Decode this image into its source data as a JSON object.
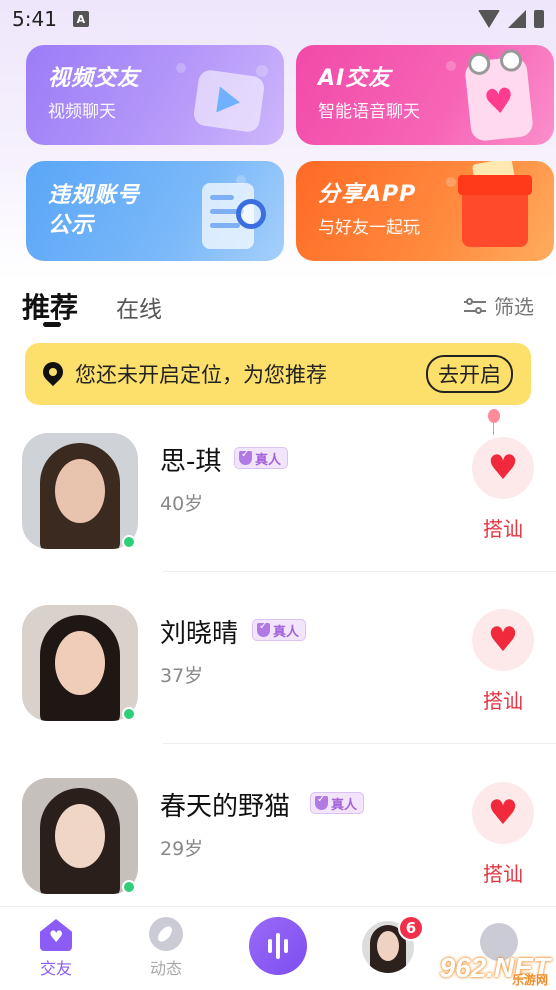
{
  "status_bar": {
    "time": "5:41"
  },
  "cards": {
    "video": {
      "title": "视频交友",
      "sub": "视频聊天"
    },
    "ai": {
      "title": "AI交友",
      "sub": "智能语音聊天"
    },
    "violation": {
      "title_line1": "违规账号",
      "title_line2": "公示"
    },
    "share": {
      "title": "分享APP",
      "sub": "与好友一起玩"
    }
  },
  "tabs": {
    "recommend": "推荐",
    "online": "在线",
    "filter": "筛选"
  },
  "location": {
    "text": "您还未开启定位，为您推荐",
    "button": "去开启"
  },
  "users": [
    {
      "name": "思-琪",
      "badge": "真人",
      "age": "40岁",
      "action": "搭讪"
    },
    {
      "name": "刘晓晴",
      "badge": "真人",
      "age": "37岁",
      "action": "搭讪"
    },
    {
      "name": "春天的野猫",
      "badge": "真人",
      "age": "29岁",
      "action": "搭讪"
    }
  ],
  "nav": {
    "home": "交友",
    "dynamic": "动态",
    "unread_count": "6"
  },
  "watermark": {
    "text": "962.NET",
    "sub": "乐游网"
  },
  "colors": {
    "accent": "#8b5cf6",
    "greet": "#e5343f",
    "banner": "#fde06b",
    "online": "#2fcf7a"
  }
}
